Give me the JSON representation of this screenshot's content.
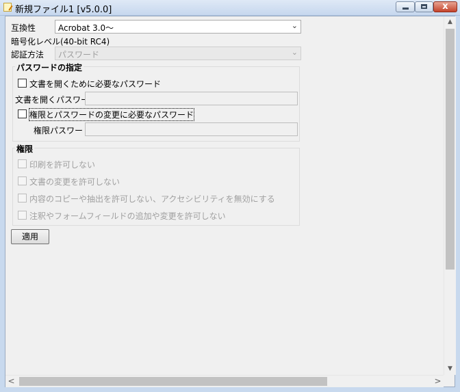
{
  "window": {
    "title": "新規ファイル1 [v5.0.0]"
  },
  "titlebar_buttons": {
    "minimize_icon": "minimize-icon",
    "restore_icon": "restore-icon",
    "close_glyph": "x"
  },
  "compat": {
    "label": "互換性",
    "value": "Acrobat 3.0〜"
  },
  "encryption": {
    "label": "暗号化レベル",
    "value": "(40-bit RC4)"
  },
  "auth": {
    "label": "認証方法",
    "value": "パスワード"
  },
  "password_group": {
    "title": "パスワードの指定",
    "open_doc_check": "文書を開くために必要なパスワード",
    "open_doc_label": "文書を開くパスワード:",
    "perm_check": "権限とパスワードの変更に必要なパスワード",
    "perm_label": "権限パスワード:"
  },
  "permissions_group": {
    "title": "権限",
    "items": [
      "印刷を許可しない",
      "文書の変更を許可しない",
      "内容のコピーや抽出を許可しない、アクセシビリティを無効にする",
      "注釈やフォームフィールドの追加や変更を許可しない"
    ]
  },
  "apply_button": "適用",
  "scroll": {
    "up": "▲",
    "down": "▼",
    "left": "<",
    "right": ">"
  }
}
